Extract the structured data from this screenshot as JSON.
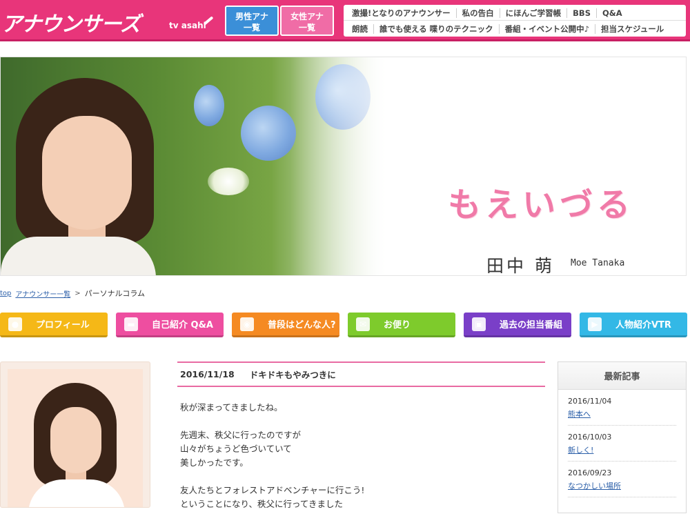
{
  "header": {
    "logo": "アナウンサーズ",
    "logo_sub": "tv asahi",
    "male_button": "男性アナ 一覧",
    "female_button": "女性アナ 一覧",
    "nav_row1": [
      "激撮!となりのアナウンサー",
      "私の告白",
      "にほんご学習帳",
      "BBS",
      "Q&A"
    ],
    "nav_row2": [
      "朗読",
      "誰でも使える 喋りのテクニック",
      "番組・イベント公開中♪",
      "担当スケジュール"
    ]
  },
  "hero": {
    "title": "もえいづる",
    "name": "田中 萌",
    "name_en": "Moe Tanaka"
  },
  "breadcrumb": {
    "top": "top",
    "list": "アナウンサー一覧",
    "separator": ">",
    "current": "パーソナルコラム"
  },
  "menu": [
    {
      "label": "プロフィール",
      "icon": "person-icon",
      "color": "#f5b817"
    },
    {
      "label": "自己紹介 Q&A",
      "icon": "chat-icon",
      "color": "#ee4ea0"
    },
    {
      "label": "普段はどんな人?",
      "icon": "camera-icon",
      "color": "#f58a22"
    },
    {
      "label": "お便り",
      "icon": "mail-icon",
      "color": "#7ecb2c"
    },
    {
      "label": "過去の担当番組",
      "icon": "program-icon",
      "color": "#7a3fc8"
    },
    {
      "label": "人物紹介VTR",
      "icon": "video-icon",
      "color": "#33b8e6"
    }
  ],
  "article": {
    "date": "2016/11/18",
    "title": "ドキドキもやみつきに",
    "paragraphs": [
      [
        "秋が深まってきましたね。"
      ],
      [
        "先週末、秩父に行ったのですが",
        "山々がちょうど色づいていて",
        "美しかったです。"
      ],
      [
        "友人たちとフォレストアドベンチャーに行こう!",
        "ということになり、秩父に行ってきました"
      ]
    ]
  },
  "sidebar": {
    "heading": "最新記事",
    "items": [
      {
        "date": "2016/11/04",
        "title": "熊本へ"
      },
      {
        "date": "2016/10/03",
        "title": "新しく!"
      },
      {
        "date": "2016/09/23",
        "title": "なつかしい場所"
      }
    ]
  },
  "colors": {
    "brand": "#e8357a",
    "accent": "#e86aa2",
    "link": "#2a5ea8"
  }
}
